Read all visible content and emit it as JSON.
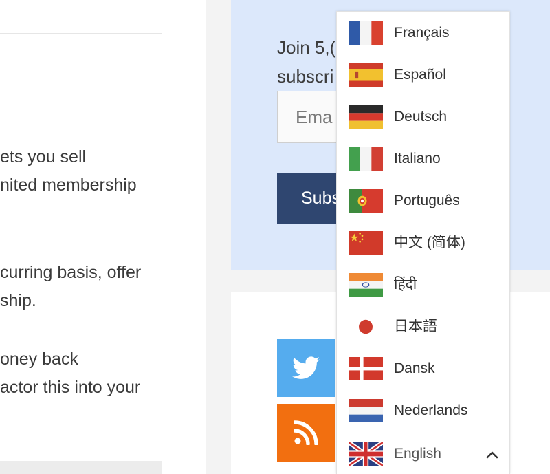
{
  "article": {
    "paragraphs": [
      [
        "ets you sell",
        "nited membership"
      ],
      [
        "curring basis, offer",
        "ship."
      ],
      [
        "oney back",
        "actor this into your"
      ]
    ]
  },
  "subscribe": {
    "lines": [
      "Join 5,(",
      "subscri"
    ],
    "email_placeholder": "Ema",
    "button_label": "Subs"
  },
  "social": {
    "twitter_icon": "twitter-bird-icon",
    "rss_icon": "rss-feed-icon",
    "twitter_color": "#55acee",
    "rss_color": "#f26f10"
  },
  "language_menu": {
    "options": [
      {
        "label": "Français",
        "flag": "fr"
      },
      {
        "label": "Español",
        "flag": "es"
      },
      {
        "label": "Deutsch",
        "flag": "de"
      },
      {
        "label": "Italiano",
        "flag": "it"
      },
      {
        "label": "Português",
        "flag": "pt"
      },
      {
        "label": "中文 (简体)",
        "flag": "cn"
      },
      {
        "label": "हिंदी",
        "flag": "in"
      },
      {
        "label": "日本語",
        "flag": "jp"
      },
      {
        "label": "Dansk",
        "flag": "dk"
      },
      {
        "label": "Nederlands",
        "flag": "nl"
      }
    ],
    "current": {
      "label": "English",
      "flag": "gb"
    }
  },
  "colors": {
    "subscribe_bg": "#dce8fb",
    "subscribe_button": "#2f4670"
  }
}
